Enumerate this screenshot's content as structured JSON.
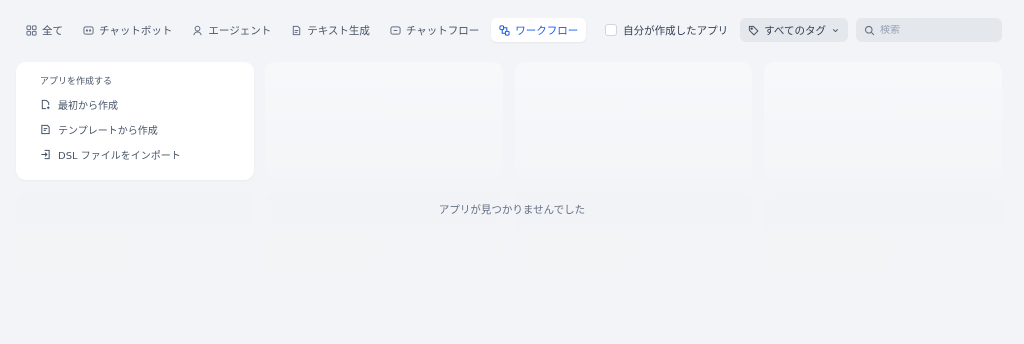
{
  "tabs": [
    {
      "label": "全て",
      "icon": "grid-icon"
    },
    {
      "label": "チャットボット",
      "icon": "chatbot-icon"
    },
    {
      "label": "エージェント",
      "icon": "agent-icon"
    },
    {
      "label": "テキスト生成",
      "icon": "text-generation-icon"
    },
    {
      "label": "チャットフロー",
      "icon": "chatflow-icon"
    },
    {
      "label": "ワークフロー",
      "icon": "workflow-icon",
      "active": true
    }
  ],
  "filters": {
    "mine_label": "自分が作成したアプリ",
    "mine_checked": false,
    "tags_label": "すべてのタグ",
    "search_placeholder": "検索",
    "search_value": ""
  },
  "create": {
    "title": "アプリを作成する",
    "items": [
      {
        "label": "最初から作成",
        "icon": "new-file-icon"
      },
      {
        "label": "テンプレートから作成",
        "icon": "template-icon"
      },
      {
        "label": "DSL ファイルをインポート",
        "icon": "import-icon"
      }
    ]
  },
  "empty_message": "アプリが見つかりませんでした",
  "colors": {
    "background": "#f2f4f7",
    "accent": "#155aef",
    "text": "#475467"
  }
}
